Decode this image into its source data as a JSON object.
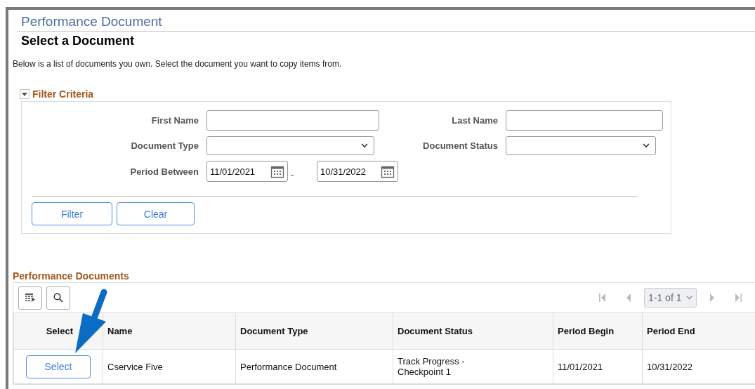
{
  "page_title": "Performance Document",
  "heading": "Select a Document",
  "description": "Below is a list of documents you own. Select the document you want to copy items from.",
  "filter": {
    "title": "Filter Criteria",
    "expanded": true,
    "first_name": {
      "label": "First Name"
    },
    "last_name": {
      "label": "Last Name"
    },
    "document_type": {
      "label": "Document Type"
    },
    "document_status": {
      "label": "Document Status"
    },
    "period": {
      "label": "Period Between",
      "from": "11/01/2021",
      "separator": "-",
      "to": "10/31/2022"
    },
    "buttons": [
      "Filter",
      "Clear"
    ]
  },
  "grid": {
    "title": "Performance Documents",
    "pager": "1-1 of 1",
    "columns": [
      "Select",
      "Name",
      "Document Type",
      "Document Status",
      "Period Begin",
      "Period End"
    ],
    "rows": [
      {
        "button": "Select",
        "name": "Cservice Five",
        "document_type": "Performance Document",
        "document_status": "Track Progress - Checkpoint 1",
        "period_begin": "11/01/2021",
        "period_end": "10/31/2022"
      }
    ]
  }
}
